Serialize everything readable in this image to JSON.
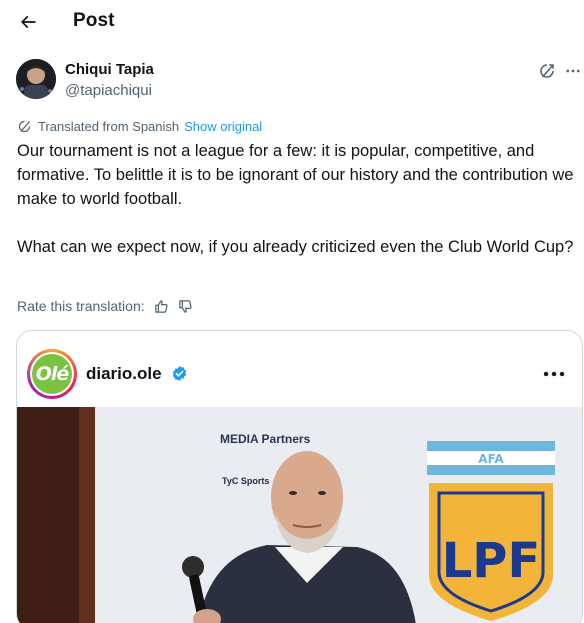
{
  "header": {
    "title": "Post"
  },
  "author": {
    "display_name": "Chiqui Tapia",
    "handle": "@tapiachiqui"
  },
  "translation": {
    "label": "Translated from Spanish",
    "show_original": "Show original",
    "rate_label": "Rate this translation:"
  },
  "tweet": {
    "paragraph_1": "Our tournament is not a league for a few: it is popular, competitive, and formative. To belittle it is to be ignorant of our history and the contribution we make to world football.",
    "paragraph_2": "What can we expect now, if you already criticized even the Club World Cup?"
  },
  "embedded": {
    "account_name": "diario.ole",
    "logo_text": "Olé",
    "image_texts": {
      "media_partners": "MEDIA Partners",
      "sponsor": "TyC Sports",
      "afa": "AFA",
      "lpf": "LPF"
    }
  },
  "colors": {
    "accent": "#1d9bf0",
    "secondary_text": "#536471",
    "border": "#cfd9de",
    "ole_green": "#7cc242",
    "lpf_gold": "#f2b53a",
    "afa_blue": "#6fb6de"
  },
  "icons": {
    "back": "arrow-left-icon",
    "grok": "grok-icon",
    "more": "more-horizontal-icon",
    "translate": "translate-icon",
    "thumb_up": "thumb-up-icon",
    "thumb_down": "thumb-down-icon",
    "verified": "verified-badge-icon"
  }
}
